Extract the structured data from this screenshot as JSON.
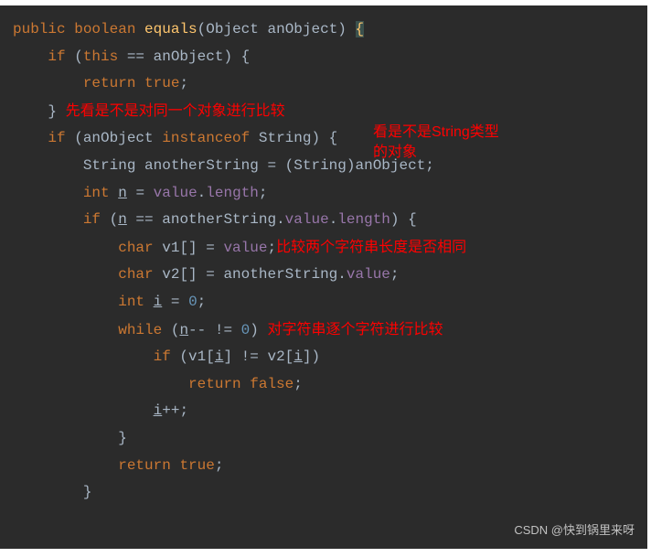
{
  "code": {
    "sig_public": "public",
    "sig_boolean": "boolean",
    "sig_equals": "equals",
    "sig_paramtype": "Object",
    "sig_param": "anObject",
    "this_kw": "this",
    "anObject": "anObject",
    "return_kw": "return",
    "true_kw": "true",
    "false_kw": "false",
    "instanceof_kw": "instanceof",
    "string_type": "String",
    "anotherString": "anotherString",
    "cast": "(String)anObject",
    "int_kw": "int",
    "n_var": "n",
    "value_member": "value",
    "length_member": "length",
    "char_kw": "char",
    "v1": "v1",
    "v2": "v2",
    "i_var": "i",
    "zero": "0",
    "while_kw": "while",
    "if_kw": "if",
    "brace_open": "{",
    "brace_close": "}",
    "bracket_pair": "[]"
  },
  "annotations": {
    "a1": "先看是不是对同一个对象进行比较",
    "a2_l1": "看是不是String类型",
    "a2_l2": "的对象",
    "a3": "比较两个字符串长度是否相同",
    "a4": "对字符串逐个字符进行比较"
  },
  "watermark": "CSDN @快到锅里来呀"
}
